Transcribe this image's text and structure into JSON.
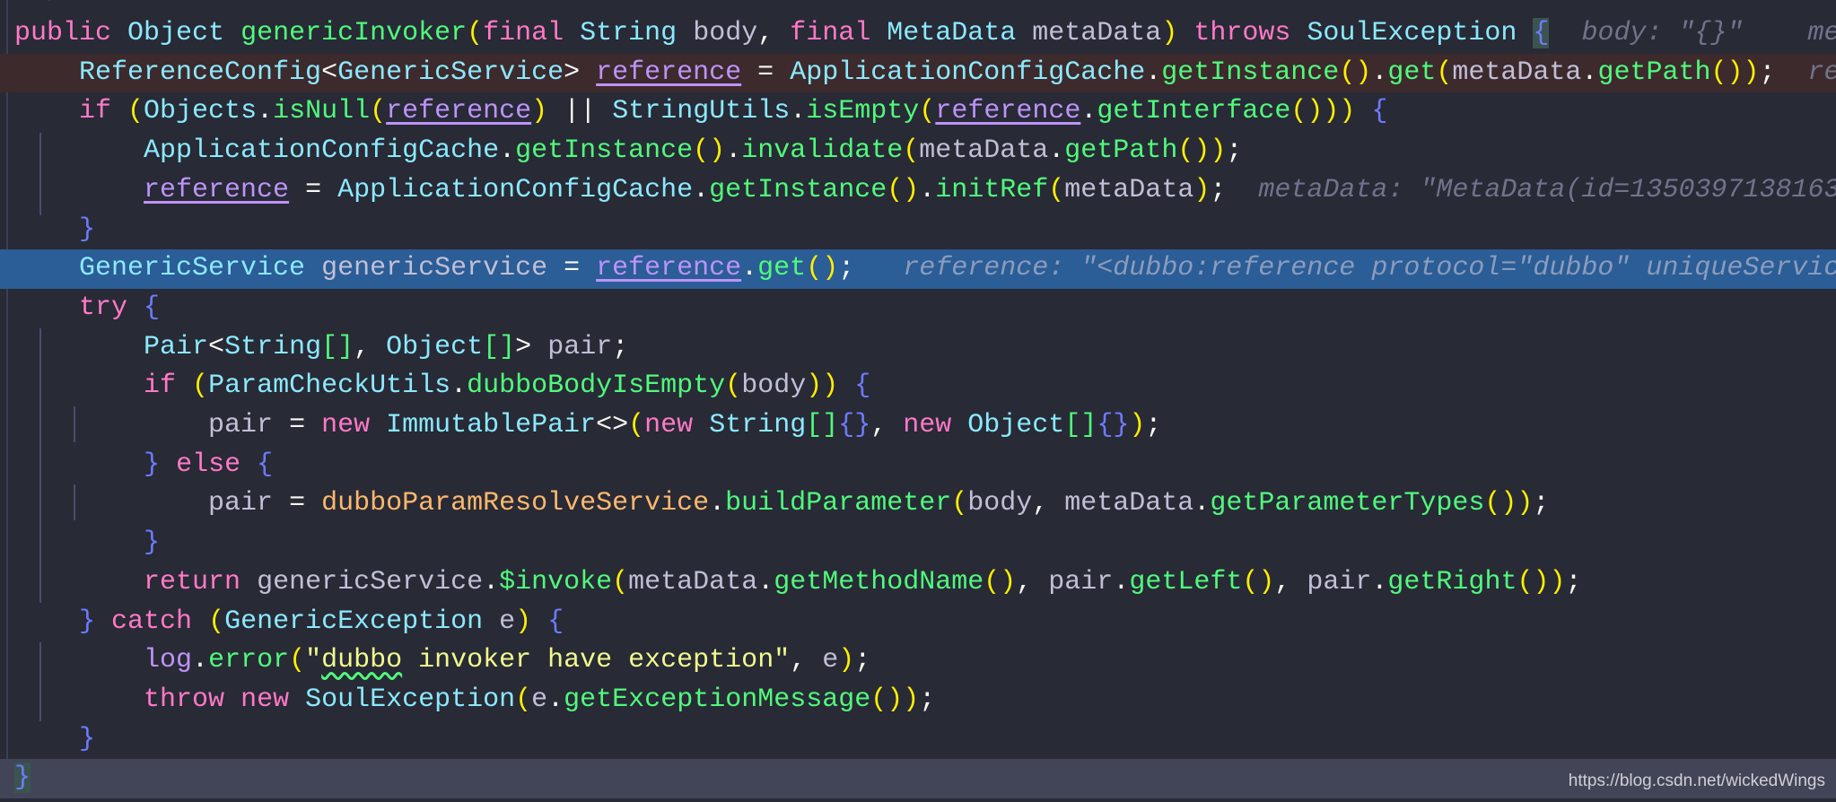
{
  "editor": {
    "theme_colors": {
      "background": "#282a36",
      "keyword": "#ff79c6",
      "type": "#8be9fd",
      "method": "#50fa7b",
      "paren": "#ffef00",
      "brace": "#6c7cff",
      "breakpoint_line": "#3d2a2d",
      "execution_line": "#2b5d96",
      "current_line": "#424557"
    },
    "lines": [
      {
        "state": "normal",
        "tokens": [
          {
            "c": "cm",
            "t": " */"
          }
        ]
      },
      {
        "state": "normal",
        "tokens": [
          {
            "c": "kw",
            "t": "public "
          },
          {
            "c": "ty",
            "t": "Object "
          },
          {
            "c": "fn",
            "t": "genericInvoker"
          },
          {
            "c": "pa",
            "t": "("
          },
          {
            "c": "kw",
            "t": "final "
          },
          {
            "c": "ty",
            "t": "String "
          },
          {
            "c": "va",
            "t": "body"
          },
          {
            "c": "op",
            "t": ", "
          },
          {
            "c": "kw",
            "t": "final "
          },
          {
            "c": "ty",
            "t": "MetaData "
          },
          {
            "c": "va",
            "t": "metaData"
          },
          {
            "c": "pa",
            "t": ")"
          },
          {
            "c": "op",
            "t": " "
          },
          {
            "c": "kw",
            "t": "throws "
          },
          {
            "c": "ty",
            "t": "SoulException "
          },
          {
            "c": "br bm",
            "t": "{"
          },
          {
            "c": "hint",
            "t": "  body: \"{}\"    me"
          }
        ]
      },
      {
        "state": "bp",
        "tokens": [
          {
            "c": "op",
            "t": "    "
          },
          {
            "c": "ty",
            "t": "ReferenceConfig"
          },
          {
            "c": "op",
            "t": "<"
          },
          {
            "c": "ty",
            "t": "GenericService"
          },
          {
            "c": "op",
            "t": "> "
          },
          {
            "c": "rf",
            "t": "reference"
          },
          {
            "c": "op",
            "t": " = "
          },
          {
            "c": "ty",
            "t": "ApplicationConfigCache"
          },
          {
            "c": "op",
            "t": "."
          },
          {
            "c": "fn",
            "t": "getInstance"
          },
          {
            "c": "pa",
            "t": "()"
          },
          {
            "c": "op",
            "t": "."
          },
          {
            "c": "fn",
            "t": "get"
          },
          {
            "c": "pa",
            "t": "("
          },
          {
            "c": "va",
            "t": "metaData"
          },
          {
            "c": "op",
            "t": "."
          },
          {
            "c": "fn",
            "t": "getPath"
          },
          {
            "c": "pa",
            "t": "())"
          },
          {
            "c": "op",
            "t": ";"
          },
          {
            "c": "hint",
            "t": "  re"
          }
        ]
      },
      {
        "state": "normal",
        "tokens": [
          {
            "c": "op",
            "t": "    "
          },
          {
            "c": "kw",
            "t": "if "
          },
          {
            "c": "pa",
            "t": "("
          },
          {
            "c": "ty",
            "t": "Objects"
          },
          {
            "c": "op",
            "t": "."
          },
          {
            "c": "fn",
            "t": "isNull"
          },
          {
            "c": "pa",
            "t": "("
          },
          {
            "c": "rf",
            "t": "reference"
          },
          {
            "c": "pa",
            "t": ")"
          },
          {
            "c": "op",
            "t": " || "
          },
          {
            "c": "ty",
            "t": "StringUtils"
          },
          {
            "c": "op",
            "t": "."
          },
          {
            "c": "fn",
            "t": "isEmpty"
          },
          {
            "c": "pa",
            "t": "("
          },
          {
            "c": "rf",
            "t": "reference"
          },
          {
            "c": "op",
            "t": "."
          },
          {
            "c": "fn",
            "t": "getInterface"
          },
          {
            "c": "pa",
            "t": "()))"
          },
          {
            "c": "op",
            "t": " "
          },
          {
            "c": "br",
            "t": "{"
          }
        ]
      },
      {
        "state": "normal",
        "tokens": [
          {
            "c": "op",
            "t": "        "
          },
          {
            "c": "ty",
            "t": "ApplicationConfigCache"
          },
          {
            "c": "op",
            "t": "."
          },
          {
            "c": "fn",
            "t": "getInstance"
          },
          {
            "c": "pa",
            "t": "()"
          },
          {
            "c": "op",
            "t": "."
          },
          {
            "c": "fn",
            "t": "invalidate"
          },
          {
            "c": "pa",
            "t": "("
          },
          {
            "c": "va",
            "t": "metaData"
          },
          {
            "c": "op",
            "t": "."
          },
          {
            "c": "fn",
            "t": "getPath"
          },
          {
            "c": "pa",
            "t": "())"
          },
          {
            "c": "op",
            "t": ";"
          }
        ]
      },
      {
        "state": "normal",
        "tokens": [
          {
            "c": "op",
            "t": "        "
          },
          {
            "c": "rf",
            "t": "reference"
          },
          {
            "c": "op",
            "t": " = "
          },
          {
            "c": "ty",
            "t": "ApplicationConfigCache"
          },
          {
            "c": "op",
            "t": "."
          },
          {
            "c": "fn",
            "t": "getInstance"
          },
          {
            "c": "pa",
            "t": "()"
          },
          {
            "c": "op",
            "t": "."
          },
          {
            "c": "fn",
            "t": "initRef"
          },
          {
            "c": "pa",
            "t": "("
          },
          {
            "c": "va",
            "t": "metaData"
          },
          {
            "c": "pa",
            "t": ")"
          },
          {
            "c": "op",
            "t": ";"
          },
          {
            "c": "hint",
            "t": "  metaData: \"MetaData(id=1350397138163"
          }
        ]
      },
      {
        "state": "normal",
        "tokens": [
          {
            "c": "op",
            "t": "    "
          },
          {
            "c": "br",
            "t": "}"
          }
        ]
      },
      {
        "state": "exec",
        "tokens": [
          {
            "c": "op",
            "t": "    "
          },
          {
            "c": "ty",
            "t": "GenericService "
          },
          {
            "c": "va",
            "t": "genericService"
          },
          {
            "c": "op",
            "t": " = "
          },
          {
            "c": "rf",
            "t": "reference"
          },
          {
            "c": "op",
            "t": "."
          },
          {
            "c": "fn",
            "t": "get"
          },
          {
            "c": "pa",
            "t": "()"
          },
          {
            "c": "op",
            "t": ";"
          },
          {
            "c": "hint",
            "t": "   reference: \"<dubbo:reference protocol=\"dubbo\" uniqueService"
          }
        ]
      },
      {
        "state": "normal",
        "tokens": [
          {
            "c": "op",
            "t": "    "
          },
          {
            "c": "kw",
            "t": "try "
          },
          {
            "c": "br",
            "t": "{"
          }
        ]
      },
      {
        "state": "normal",
        "tokens": [
          {
            "c": "op",
            "t": "        "
          },
          {
            "c": "ty",
            "t": "Pair"
          },
          {
            "c": "op",
            "t": "<"
          },
          {
            "c": "ty",
            "t": "String"
          },
          {
            "c": "fn",
            "t": "[]"
          },
          {
            "c": "op",
            "t": ", "
          },
          {
            "c": "ty",
            "t": "Object"
          },
          {
            "c": "fn",
            "t": "[]"
          },
          {
            "c": "op",
            "t": "> "
          },
          {
            "c": "va",
            "t": "pair"
          },
          {
            "c": "op",
            "t": ";"
          }
        ]
      },
      {
        "state": "normal",
        "tokens": [
          {
            "c": "op",
            "t": "        "
          },
          {
            "c": "kw",
            "t": "if "
          },
          {
            "c": "pa",
            "t": "("
          },
          {
            "c": "ty",
            "t": "ParamCheckUtils"
          },
          {
            "c": "op",
            "t": "."
          },
          {
            "c": "fn",
            "t": "dubboBodyIsEmpty"
          },
          {
            "c": "pa",
            "t": "("
          },
          {
            "c": "va",
            "t": "body"
          },
          {
            "c": "pa",
            "t": "))"
          },
          {
            "c": "op",
            "t": " "
          },
          {
            "c": "br",
            "t": "{"
          }
        ]
      },
      {
        "state": "normal",
        "tokens": [
          {
            "c": "op",
            "t": "            "
          },
          {
            "c": "va",
            "t": "pair"
          },
          {
            "c": "op",
            "t": " = "
          },
          {
            "c": "kw",
            "t": "new "
          },
          {
            "c": "ty",
            "t": "ImmutablePair"
          },
          {
            "c": "op",
            "t": "<>"
          },
          {
            "c": "pa",
            "t": "("
          },
          {
            "c": "kw",
            "t": "new "
          },
          {
            "c": "ty",
            "t": "String"
          },
          {
            "c": "fn",
            "t": "[]"
          },
          {
            "c": "br",
            "t": "{}"
          },
          {
            "c": "op",
            "t": ", "
          },
          {
            "c": "kw",
            "t": "new "
          },
          {
            "c": "ty",
            "t": "Object"
          },
          {
            "c": "fn",
            "t": "[]"
          },
          {
            "c": "br",
            "t": "{}"
          },
          {
            "c": "pa",
            "t": ")"
          },
          {
            "c": "op",
            "t": ";"
          }
        ]
      },
      {
        "state": "normal",
        "tokens": [
          {
            "c": "op",
            "t": "        "
          },
          {
            "c": "br",
            "t": "}"
          },
          {
            "c": "op",
            "t": " "
          },
          {
            "c": "kw",
            "t": "else "
          },
          {
            "c": "br",
            "t": "{"
          }
        ]
      },
      {
        "state": "normal",
        "tokens": [
          {
            "c": "op",
            "t": "            "
          },
          {
            "c": "va",
            "t": "pair"
          },
          {
            "c": "op",
            "t": " = "
          },
          {
            "c": "fi",
            "t": "dubboParamResolveService"
          },
          {
            "c": "op",
            "t": "."
          },
          {
            "c": "fn",
            "t": "buildParameter"
          },
          {
            "c": "pa",
            "t": "("
          },
          {
            "c": "va",
            "t": "body"
          },
          {
            "c": "op",
            "t": ", "
          },
          {
            "c": "va",
            "t": "metaData"
          },
          {
            "c": "op",
            "t": "."
          },
          {
            "c": "fn",
            "t": "getParameterTypes"
          },
          {
            "c": "pa",
            "t": "())"
          },
          {
            "c": "op",
            "t": ";"
          }
        ]
      },
      {
        "state": "normal",
        "tokens": [
          {
            "c": "op",
            "t": "        "
          },
          {
            "c": "br",
            "t": "}"
          }
        ]
      },
      {
        "state": "normal",
        "tokens": [
          {
            "c": "op",
            "t": "        "
          },
          {
            "c": "kw",
            "t": "return "
          },
          {
            "c": "va",
            "t": "genericService"
          },
          {
            "c": "op",
            "t": "."
          },
          {
            "c": "fn",
            "t": "$invoke"
          },
          {
            "c": "pa",
            "t": "("
          },
          {
            "c": "va",
            "t": "metaData"
          },
          {
            "c": "op",
            "t": "."
          },
          {
            "c": "fn",
            "t": "getMethodName"
          },
          {
            "c": "pa",
            "t": "()"
          },
          {
            "c": "op",
            "t": ", "
          },
          {
            "c": "va",
            "t": "pair"
          },
          {
            "c": "op",
            "t": "."
          },
          {
            "c": "fn",
            "t": "getLeft"
          },
          {
            "c": "pa",
            "t": "()"
          },
          {
            "c": "op",
            "t": ", "
          },
          {
            "c": "va",
            "t": "pair"
          },
          {
            "c": "op",
            "t": "."
          },
          {
            "c": "fn",
            "t": "getRight"
          },
          {
            "c": "pa",
            "t": "())"
          },
          {
            "c": "op",
            "t": ";"
          }
        ]
      },
      {
        "state": "normal",
        "tokens": [
          {
            "c": "op",
            "t": "    "
          },
          {
            "c": "br",
            "t": "}"
          },
          {
            "c": "op",
            "t": " "
          },
          {
            "c": "kw",
            "t": "catch "
          },
          {
            "c": "pa",
            "t": "("
          },
          {
            "c": "ty",
            "t": "GenericException "
          },
          {
            "c": "va",
            "t": "e"
          },
          {
            "c": "pa",
            "t": ")"
          },
          {
            "c": "op",
            "t": " "
          },
          {
            "c": "br",
            "t": "{"
          }
        ]
      },
      {
        "state": "normal",
        "tokens": [
          {
            "c": "op",
            "t": "        "
          },
          {
            "c": "rf",
            "t": "log",
            "n": "nounder"
          },
          {
            "c": "op",
            "t": "."
          },
          {
            "c": "fn",
            "t": "error"
          },
          {
            "c": "pa",
            "t": "("
          },
          {
            "c": "st",
            "t": "\""
          },
          {
            "c": "sq",
            "t": "dubbo"
          },
          {
            "c": "st",
            "t": " invoker have exception\""
          },
          {
            "c": "op",
            "t": ", "
          },
          {
            "c": "va",
            "t": "e"
          },
          {
            "c": "pa",
            "t": ")"
          },
          {
            "c": "op",
            "t": ";"
          }
        ]
      },
      {
        "state": "normal",
        "tokens": [
          {
            "c": "op",
            "t": "        "
          },
          {
            "c": "kw",
            "t": "throw "
          },
          {
            "c": "kw",
            "t": "new "
          },
          {
            "c": "ty",
            "t": "SoulException"
          },
          {
            "c": "pa",
            "t": "("
          },
          {
            "c": "va",
            "t": "e"
          },
          {
            "c": "op",
            "t": "."
          },
          {
            "c": "fn",
            "t": "getExceptionMessage"
          },
          {
            "c": "pa",
            "t": "())"
          },
          {
            "c": "op",
            "t": ";"
          }
        ]
      },
      {
        "state": "normal",
        "tokens": [
          {
            "c": "op",
            "t": "    "
          },
          {
            "c": "br",
            "t": "}"
          }
        ]
      },
      {
        "state": "current",
        "tokens": [
          {
            "c": "br bm",
            "t": "}"
          }
        ]
      }
    ]
  },
  "watermark": "https://blog.csdn.net/wickedWings"
}
